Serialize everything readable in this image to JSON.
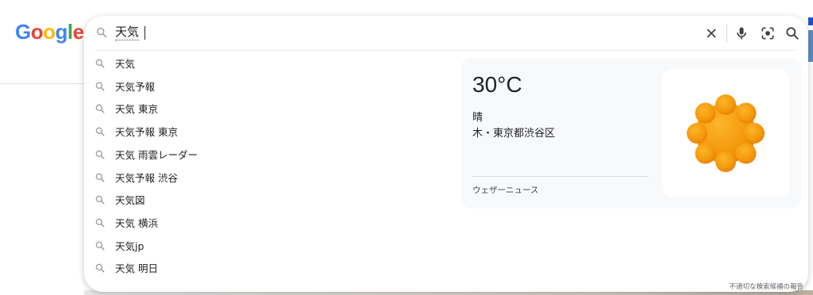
{
  "logo": {
    "text": "Google",
    "letters": [
      {
        "ch": "G",
        "color": "#4285F4"
      },
      {
        "ch": "o",
        "color": "#EA4335"
      },
      {
        "ch": "o",
        "color": "#FBBC05"
      },
      {
        "ch": "g",
        "color": "#4285F4"
      },
      {
        "ch": "l",
        "color": "#34A853"
      },
      {
        "ch": "e",
        "color": "#EA4335"
      }
    ]
  },
  "search": {
    "query": "天気",
    "icons": [
      "search-icon",
      "clear-icon",
      "mic-icon",
      "lens-icon",
      "search-submit-icon"
    ]
  },
  "suggestions": [
    {
      "text": "天気"
    },
    {
      "text": "天気予報"
    },
    {
      "text": "天気 東京"
    },
    {
      "text": "天気予報 東京"
    },
    {
      "text": "天気 雨雲レーダー"
    },
    {
      "text": "天気予報 渋谷"
    },
    {
      "text": "天気図"
    },
    {
      "text": "天気 横浜"
    },
    {
      "text": "天気jp"
    },
    {
      "text": "天気 明日"
    }
  ],
  "weather": {
    "temperature": "30°C",
    "condition": "晴",
    "location": "木・東京都渋谷区",
    "source": "ウェザーニュース",
    "icon": "sun-icon"
  },
  "footer": {
    "report": "不適切な検索候補の報告"
  },
  "colors": {
    "accent_blue": "#1a73e8",
    "sun_orange": "#F29900"
  }
}
